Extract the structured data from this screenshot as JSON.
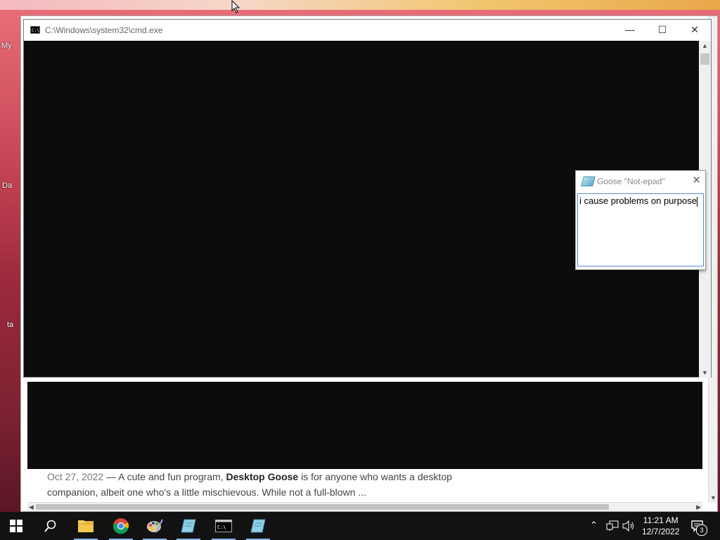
{
  "desktop": {
    "labels": [
      "My",
      "Da",
      "ta"
    ]
  },
  "browser": {
    "snippet": {
      "date": "Oct 27, 2022",
      "separator": " — A cute and fun program, ",
      "bold": "Desktop Goose",
      "rest": " is for anyone who wants a desktop companion, albeit one who's a little mischievous. While not a full-blown ..."
    }
  },
  "cmd": {
    "title": "C:\\Windows\\system32\\cmd.exe",
    "minimize": "—",
    "maximize": "☐",
    "close": "✕"
  },
  "goose_note": {
    "title": "Goose \"Not-epad\"",
    "close": "✕",
    "text": "i cause problems on purpose"
  },
  "taskbar": {
    "items": [
      "start",
      "search",
      "file-explorer",
      "chrome",
      "paint",
      "goose-notepad",
      "cmd",
      "goose-notepad-2"
    ],
    "time": "11:21 AM",
    "date": "12/7/2022",
    "notification_count": "3",
    "accent": "#8ab4e8"
  }
}
